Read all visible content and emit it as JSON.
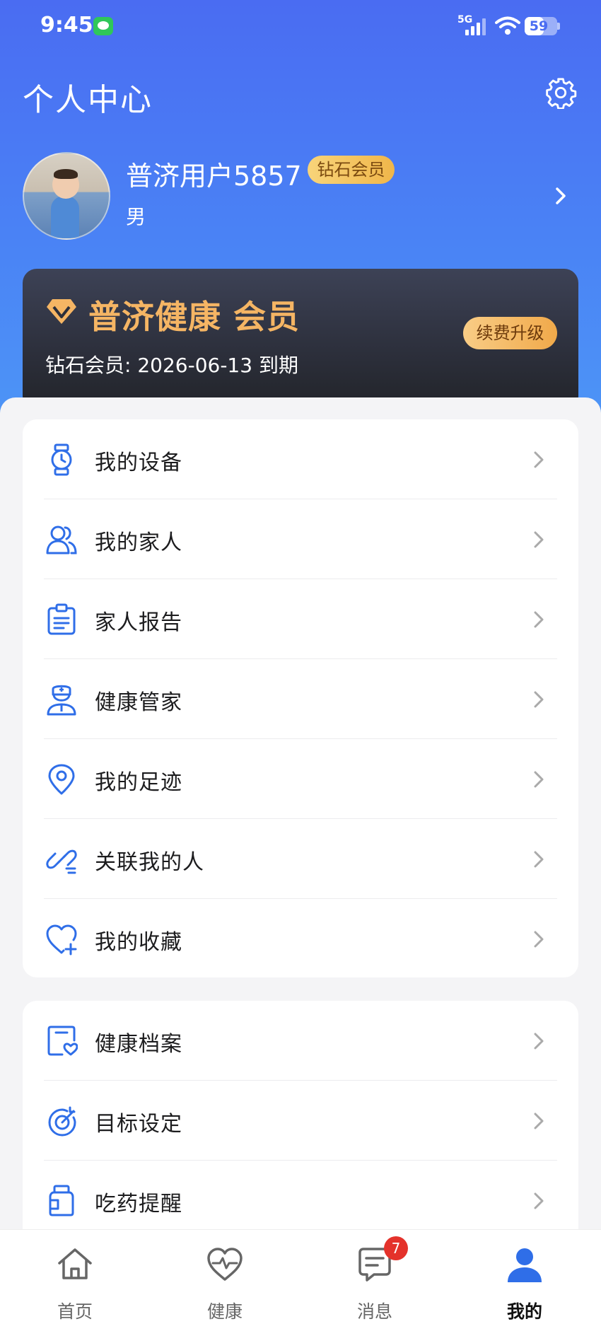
{
  "status_bar": {
    "time": "9:45",
    "network": "5G",
    "battery_level": "59",
    "battery_fraction": 0.59
  },
  "header": {
    "title": "个人中心",
    "settings_icon": "gear-icon"
  },
  "profile": {
    "name": "普济用户5857",
    "member_badge": "钻石会员",
    "gender": "男"
  },
  "vip_card": {
    "title": "普济健康 会员",
    "expiry": "钻石会员: 2026-06-13 到期",
    "renew_button": "续费升级",
    "accent_color": "#f5b564"
  },
  "menu_group_1": [
    {
      "label": "我的设备",
      "icon": "watch-icon"
    },
    {
      "label": "我的家人",
      "icon": "family-icon"
    },
    {
      "label": "家人报告",
      "icon": "clipboard-icon"
    },
    {
      "label": "健康管家",
      "icon": "doctor-icon"
    },
    {
      "label": "我的足迹",
      "icon": "location-pin-icon"
    },
    {
      "label": "关联我的人",
      "icon": "link-icon"
    },
    {
      "label": "我的收藏",
      "icon": "heart-plus-icon"
    }
  ],
  "menu_group_2": [
    {
      "label": "健康档案",
      "icon": "health-record-icon"
    },
    {
      "label": "目标设定",
      "icon": "target-icon"
    },
    {
      "label": "吃药提醒",
      "icon": "pill-bottle-icon"
    }
  ],
  "tab_bar": {
    "tabs": [
      {
        "label": "首页",
        "icon": "home-icon"
      },
      {
        "label": "健康",
        "icon": "heart-pulse-icon"
      },
      {
        "label": "消息",
        "icon": "message-icon"
      },
      {
        "label": "我的",
        "icon": "user-icon"
      }
    ],
    "message_badge": "7",
    "active_tab": "我的",
    "accent_color": "#2f6ee8"
  }
}
